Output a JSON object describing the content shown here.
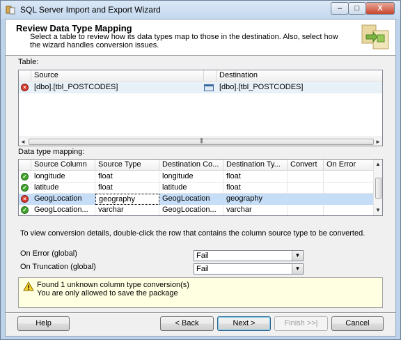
{
  "window": {
    "title": "SQL Server Import and Export Wizard",
    "controls": {
      "minimize": "–",
      "maximize": "□",
      "close": "X"
    }
  },
  "header": {
    "title": "Review Data Type Mapping",
    "description": "Select a table to review how its data types map to those in the destination. Also, select how the wizard handles conversion issues."
  },
  "table_section": {
    "label": "Table:",
    "columns": [
      "Source",
      "Destination"
    ],
    "rows": [
      {
        "status": "error",
        "source": "[dbo].[tbl_POSTCODES]",
        "destination": "[dbo].[tbl_POSTCODES]"
      }
    ]
  },
  "mapping_section": {
    "label": "Data type mapping:",
    "columns": [
      "Source Column",
      "Source Type",
      "Destination Co...",
      "Destination Ty...",
      "Convert",
      "On Error"
    ],
    "rows": [
      {
        "status": "ok",
        "cells": [
          "longitude",
          "float",
          "longitude",
          "float",
          "",
          ""
        ]
      },
      {
        "status": "ok",
        "cells": [
          "latitude",
          "float",
          "latitude",
          "float",
          "",
          ""
        ]
      },
      {
        "status": "error",
        "selected": true,
        "cells": [
          "GeogLocation",
          "geography",
          "GeogLocation",
          "geography",
          "",
          ""
        ]
      },
      {
        "status": "ok",
        "cells": [
          "GeogLocation...",
          "varchar",
          "GeogLocation...",
          "varchar",
          "",
          ""
        ]
      }
    ]
  },
  "hint": "To view conversion details, double-click the row that contains the column source type to be converted.",
  "on_error": {
    "label": "On Error (global)",
    "value": "Fail"
  },
  "on_truncation": {
    "label": "On Truncation (global)",
    "value": "Fail"
  },
  "message": {
    "line1": "Found 1 unknown column type conversion(s)",
    "line2": "You are only allowed to save the package"
  },
  "buttons": {
    "help": "Help",
    "back": "< Back",
    "next": "Next >",
    "finish": "Finish >>|",
    "cancel": "Cancel"
  },
  "icons": {
    "error": "error-icon",
    "ok": "success-icon",
    "warning": "warning-icon",
    "table": "table-icon",
    "wizard": "wizard-icon"
  }
}
